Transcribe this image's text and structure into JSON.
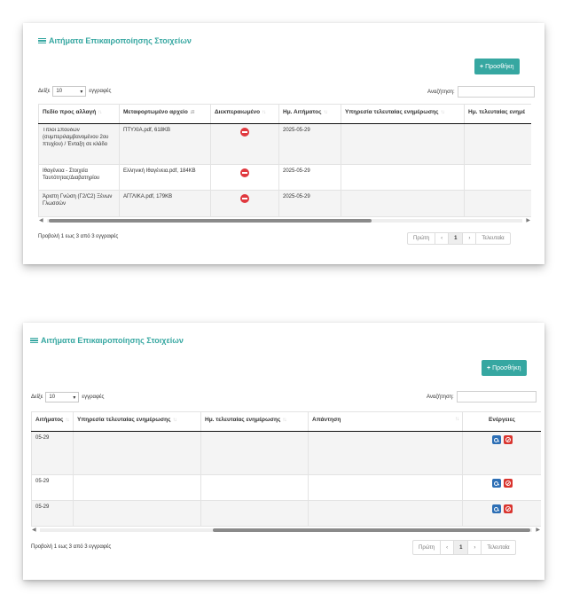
{
  "title": "Αιτήματα Επικαιροποίησης Στοιχείων",
  "add_button": "Προσθήκη",
  "length_prefix": "Δείξε",
  "length_value": "10",
  "length_suffix": "εγγραφές",
  "search_label": "Αναζήτηση:",
  "search_value": "",
  "columns": [
    "Πεδίο προς αλλαγή",
    "Μεταφορτωμένο αρχείο",
    "Διεκπεραιωμένο",
    "Ημ. Αιτήματος",
    "Υπηρεσία τελευταίας ενημέρωσης",
    "Ημ. τελευταίας ενημέρωσης",
    "Απάντηση",
    "Ενέργειες"
  ],
  "panel1_last_header": "Ημ. τελευταίας ενημέ",
  "panel2_first_header": "Αιτήματος",
  "rows": [
    {
      "field": "Τίτλοι Σπουδών (συμπεριλαμβανομένου 2ου πτυχίου) / Ένταξη σε κλάδο",
      "file": "ΠΤΥΧΙΑ.pdf, 618KB",
      "date": "2025-05-29",
      "date_cut": "05-29"
    },
    {
      "field": "Ιθαγένεια - Στοιχεία Ταυτότητας/Διαβατηρίου",
      "file": "Ελληνική Ιθαγένεια.pdf, 184KB",
      "date": "2025-05-29",
      "date_cut": "05-29"
    },
    {
      "field": "Άριστη Γνώση (Γ2/C2) Ξένων Γλωσσών",
      "file": "ΑΓΓΛΙΚΑ.pdf, 179KB",
      "date": "2025-05-29",
      "date_cut": "05-29"
    }
  ],
  "info_text": "Προβολή 1 εως 3 από 3 εγγραφές",
  "pager": {
    "first": "Πρώτη",
    "prev": "‹",
    "current": "1",
    "next": "›",
    "last": "Τελευταία"
  },
  "colors": {
    "accent": "#36a7a1",
    "danger": "#d9342e",
    "primary": "#2d6fb5"
  }
}
